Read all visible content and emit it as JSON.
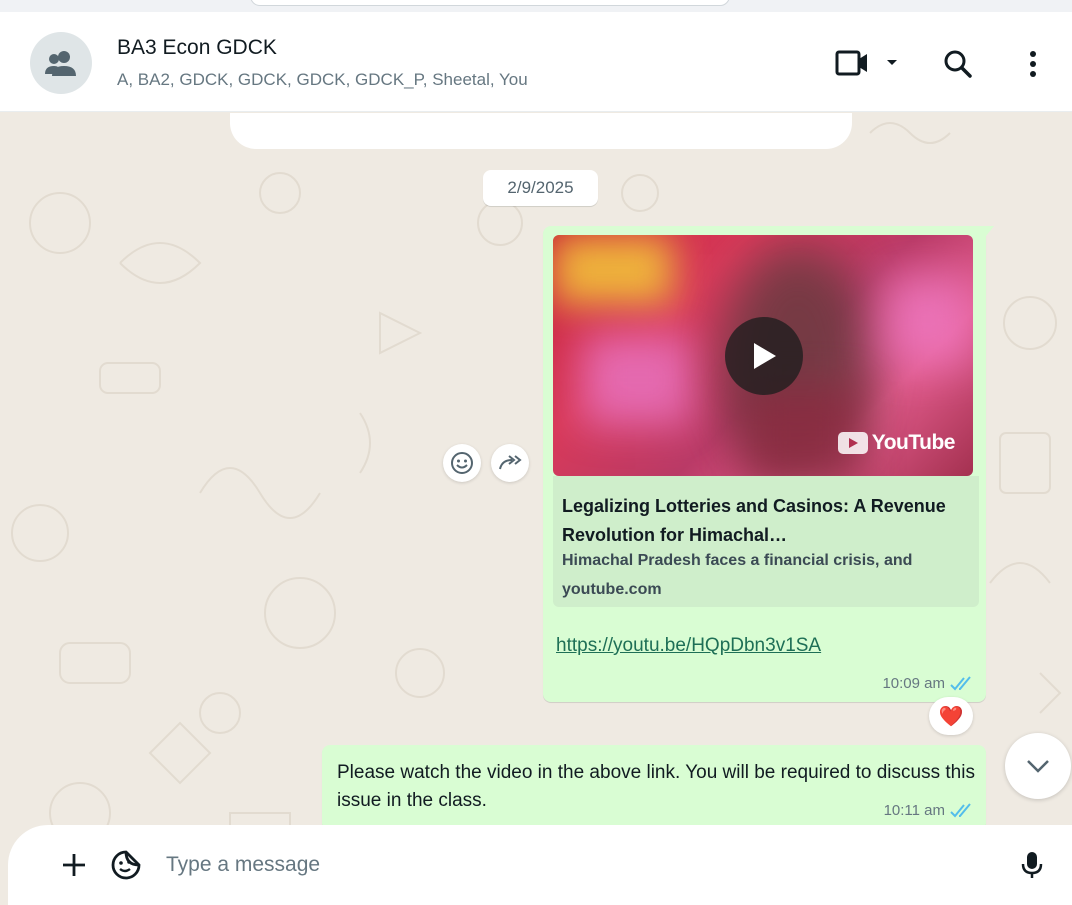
{
  "header": {
    "title": "BA3 Econ GDCK",
    "members": "A, BA2, GDCK, GDCK, GDCK, GDCK_P, Sheetal, You"
  },
  "date_chip": "2/9/2025",
  "messages": [
    {
      "preview": {
        "title": "Legalizing Lotteries and Casinos: A Revenue Revolution for Himachal…",
        "description": "Himachal Pradesh faces a financial crisis, and",
        "domain": "youtube.com",
        "brand": "YouTube"
      },
      "link": "https://youtu.be/HQpDbn3v1SA",
      "time": "10:09 am",
      "reaction": "❤️"
    },
    {
      "text": "Please watch the video in the above link. You will be required to discuss this issue in the class.",
      "time": "10:11 am"
    }
  ],
  "composer": {
    "placeholder": "Type a message"
  },
  "colors": {
    "outgoing_bubble": "#d9fdd3",
    "chat_bg": "#efeae2",
    "tick_blue": "#53bdeb"
  }
}
